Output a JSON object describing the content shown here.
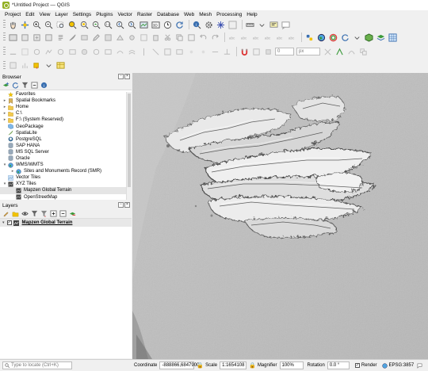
{
  "window": {
    "title": "*Untitled Project — QGIS"
  },
  "menubar": {
    "items": [
      "Project",
      "Edit",
      "View",
      "Layer",
      "Settings",
      "Plugins",
      "Vector",
      "Raster",
      "Database",
      "Web",
      "Mesh",
      "Processing",
      "Help"
    ]
  },
  "toolbar": {
    "coord_field_value": "0",
    "unit_value": "px"
  },
  "browser": {
    "title": "Browser",
    "items": [
      {
        "label": "Favorites",
        "expand": "",
        "icon": "star-icon",
        "indent": 0
      },
      {
        "label": "Spatial Bookmarks",
        "expand": "▸",
        "icon": "bookmark-icon",
        "indent": 0
      },
      {
        "label": "Home",
        "expand": "▸",
        "icon": "folder-icon",
        "indent": 0
      },
      {
        "label": "C:\\",
        "expand": "▸",
        "icon": "folder-icon",
        "indent": 0
      },
      {
        "label": "F:\\ (System Reserved)",
        "expand": "▸",
        "icon": "folder-icon",
        "indent": 0
      },
      {
        "label": "GeoPackage",
        "expand": "",
        "icon": "geopackage-icon",
        "indent": 0
      },
      {
        "label": "SpatiaLite",
        "expand": "",
        "icon": "spatialite-icon",
        "indent": 0
      },
      {
        "label": "PostgreSQL",
        "expand": "",
        "icon": "postgresql-icon",
        "indent": 0
      },
      {
        "label": "SAP HANA",
        "expand": "",
        "icon": "database-icon",
        "indent": 0
      },
      {
        "label": "MS SQL Server",
        "expand": "",
        "icon": "database-icon",
        "indent": 0
      },
      {
        "label": "Oracle",
        "expand": "",
        "icon": "database-icon",
        "indent": 0
      },
      {
        "label": "WMS/WMTS",
        "expand": "▾",
        "icon": "globe-icon",
        "indent": 0
      },
      {
        "label": "Sites and Monuments Record (SMR)",
        "expand": "▸",
        "icon": "globe-icon",
        "indent": 1
      },
      {
        "label": "Vector Tiles",
        "expand": "",
        "icon": "vector-tiles-icon",
        "indent": 0
      },
      {
        "label": "XYZ Tiles",
        "expand": "▾",
        "icon": "xyz-tiles-icon",
        "indent": 0
      },
      {
        "label": "Mapzen Global Terrain",
        "expand": "",
        "icon": "xyz-tiles-icon",
        "indent": 1,
        "selected": true
      },
      {
        "label": "OpenStreetMap",
        "expand": "",
        "icon": "xyz-tiles-icon",
        "indent": 1
      }
    ]
  },
  "layers": {
    "title": "Layers",
    "items": [
      {
        "label": "Mapzen Global Terrain",
        "checked": true
      }
    ]
  },
  "statusbar": {
    "locator_placeholder": "Type to locate (Ctrl+K)",
    "coordinate_label": "Coordinate",
    "coordinate_value": "-888866,6847900",
    "scale_label": "Scale",
    "scale_value": "1:1654108",
    "magnifier_label": "Magnifier",
    "magnifier_value": "100%",
    "rotation_label": "Rotation",
    "rotation_value": "0.0 °",
    "render_label": "Render",
    "crs_label": "EPSG:3857"
  },
  "colors": {
    "qgis_green": "#93b023",
    "map_background": "#bdbdbd",
    "panel_bg": "#f0f0f0"
  }
}
